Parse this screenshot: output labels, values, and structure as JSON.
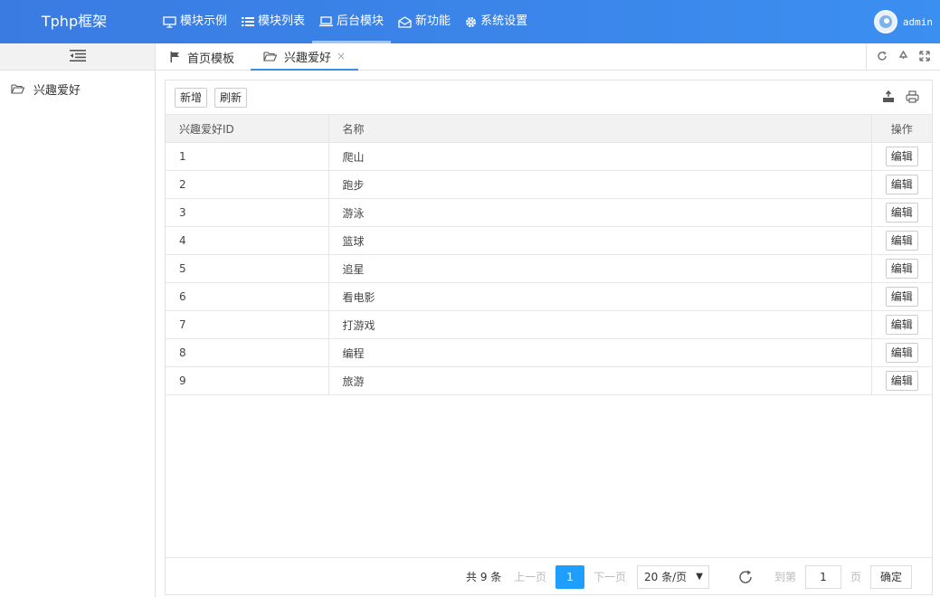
{
  "header": {
    "logo": "Tphp框架",
    "nav": [
      {
        "label": "模块示例",
        "icon": "monitor-icon"
      },
      {
        "label": "模块列表",
        "icon": "list-icon"
      },
      {
        "label": "后台模块",
        "icon": "laptop-icon"
      },
      {
        "label": "新功能",
        "icon": "envelope-open-icon"
      },
      {
        "label": "系统设置",
        "icon": "gear-icon"
      }
    ],
    "active_nav": "后台模块",
    "user": "admin"
  },
  "sidebar": {
    "toggle_icon": "indent-icon",
    "items": [
      {
        "label": "兴趣爱好",
        "icon": "folder-open-icon"
      }
    ]
  },
  "tabs": [
    {
      "label": "首页模板",
      "icon": "flag-icon"
    },
    {
      "label": "兴趣爱好",
      "icon": "folder-open-icon",
      "close": "×"
    }
  ],
  "tab_tools": [
    "refresh-icon",
    "recycle-icon",
    "fullscreen-icon"
  ],
  "toolbar": {
    "add_label": "新增",
    "refresh_label": "刷新"
  },
  "table": {
    "headers": [
      "兴趣爱好ID",
      "名称",
      "操作"
    ],
    "action_label": "编辑",
    "rows": [
      {
        "id": "1",
        "name": "爬山"
      },
      {
        "id": "2",
        "name": "跑步"
      },
      {
        "id": "3",
        "name": "游泳"
      },
      {
        "id": "4",
        "name": "篮球"
      },
      {
        "id": "5",
        "name": "追星"
      },
      {
        "id": "6",
        "name": "看电影"
      },
      {
        "id": "7",
        "name": "打游戏"
      },
      {
        "id": "8",
        "name": "编程"
      },
      {
        "id": "9",
        "name": "旅游"
      }
    ]
  },
  "pager": {
    "total": "共 9 条",
    "prev": "上一页",
    "current": "1",
    "next": "下一页",
    "page_size": "20 条/页",
    "goto_label": "到第",
    "goto_value": "1",
    "page_unit": "页",
    "confirm": "确定"
  },
  "colors": {
    "header": "#3b86ea",
    "accent": "#1e9fff"
  }
}
